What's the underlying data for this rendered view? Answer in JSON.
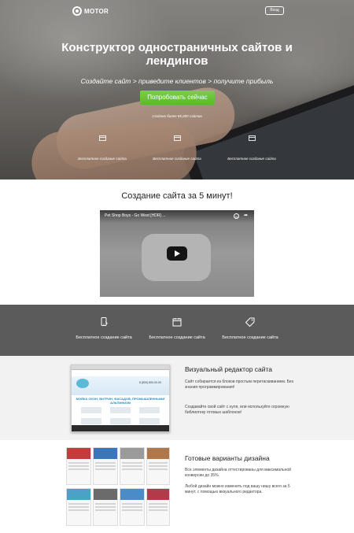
{
  "header": {
    "logo_text": "MOTOR",
    "login_label": "Вход"
  },
  "hero": {
    "title": "Конструктор одностраничных сайтов и лендингов",
    "subtitle": "Создайте сайт > приведите клиентов > получите прибыль",
    "cta_label": "Попробовать сейчас",
    "note": "Создано более 85,000 сайтов",
    "features": [
      {
        "label": "Бесплатное создание сайта",
        "icon": "browser-icon"
      },
      {
        "label": "Бесплатное создание сайта",
        "icon": "browser-icon"
      },
      {
        "label": "Бесплатное создание сайта",
        "icon": "browser-icon"
      }
    ]
  },
  "video": {
    "section_title": "Создание сайта за 5 минут!",
    "video_title": "Pet Shop Boys - Go West [HDR] ...",
    "icons": [
      "clock-icon",
      "share-icon",
      "play-icon"
    ]
  },
  "strip": {
    "features": [
      {
        "label": "Бесплатное создание сайта",
        "icon": "mobile-icon"
      },
      {
        "label": "Бесплатное создание сайта",
        "icon": "calendar-icon"
      },
      {
        "label": "Бесплатное создание сайта",
        "icon": "tag-icon"
      }
    ]
  },
  "editor": {
    "title": "Визуальный редактор сайта",
    "p1": "Сайт собирается из блоков простым перетаскиванием. Без знания программирования!",
    "p2": "Создавайте свой сайт с нуля, или используйте огромную библиотеку готовых шаблонов!",
    "mock_phone": "8 (800) 800-00-00",
    "mock_heading": "МОЙКА ОКОН, ВИТРИН, ФАСАДОВ, ПРОМЫШЛЕННЫМИ АЛЬПИНИЗМ"
  },
  "templates": {
    "title": "Готовые варианты дизайна",
    "p1": "Все элементы дизайна оттестированы для максимальной конверсии до 35%.",
    "p2": "Любой дизайн можно изменить под вашу нишу всего за 5 минут, с помощью визуального редактора."
  },
  "colors": {
    "cta_green": "#5cb82d",
    "strip_gray": "#5b5b5b",
    "section_gray": "#f2f2f2"
  }
}
